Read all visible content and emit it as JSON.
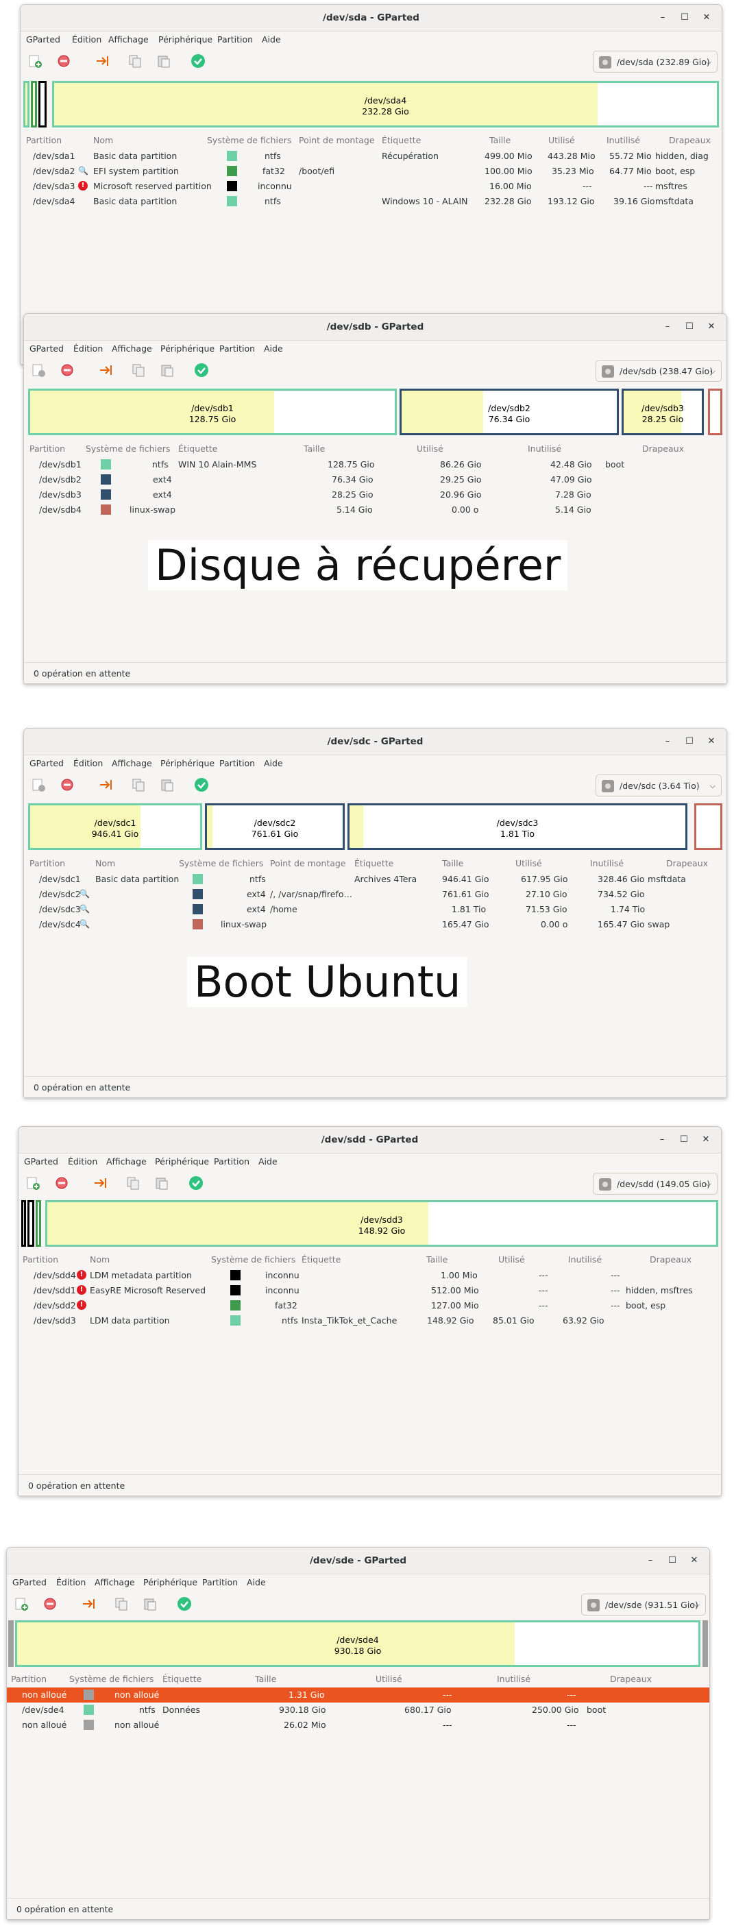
{
  "menu": [
    "GParted",
    "Édition",
    "Affichage",
    "Périphérique",
    "Partition",
    "Aide"
  ],
  "status": "0 opération en attente",
  "colors": {
    "ntfs": "#6fcfa7",
    "fat32": "#3e9c4c",
    "ext4": "#314e6c",
    "swap": "#c1665a",
    "inconnu": "#000000",
    "nonalloue": "#a0a0a0",
    "selection": "#e95420"
  },
  "sda": {
    "title": "/dev/sda - GParted",
    "device": "/dev/sda (232.89 Gio)",
    "bar": {
      "name": "/dev/sda4",
      "size": "232.28 Gio"
    },
    "headers": [
      "Partition",
      "Nom",
      "Système de fichiers",
      "Point de montage",
      "Étiquette",
      "Taille",
      "Utilisé",
      "Inutilisé",
      "Drapeaux"
    ],
    "rows": [
      {
        "part": "/dev/sda1",
        "nom": "Basic data partition",
        "fs": "ntfs",
        "mount": "",
        "label": "Récupération",
        "size": "499.00 Mio",
        "used": "443.28 Mio",
        "unused": "55.72 Mio",
        "flags": "hidden, diag"
      },
      {
        "part": "/dev/sda2",
        "nom": "EFI system partition",
        "fs": "fat32",
        "mount": "/boot/efi",
        "label": "",
        "size": "100.00 Mio",
        "used": "35.23 Mio",
        "unused": "64.77 Mio",
        "flags": "boot, esp"
      },
      {
        "part": "/dev/sda3",
        "nom": "Microsoft reserved partition",
        "fs": "inconnu",
        "mount": "",
        "label": "",
        "size": "16.00 Mio",
        "used": "---",
        "unused": "---",
        "flags": "msftres"
      },
      {
        "part": "/dev/sda4",
        "nom": "Basic data partition",
        "fs": "ntfs",
        "mount": "",
        "label": "Windows 10 - ALAIN",
        "size": "232.28 Gio",
        "used": "193.12 Gio",
        "unused": "39.16 Gio",
        "flags": "msftdata"
      }
    ]
  },
  "sdb": {
    "title": "/dev/sdb - GParted",
    "device": "/dev/sdb (238.47 Gio)",
    "bars": [
      {
        "name": "/dev/sdb1",
        "size": "128.75 Gio"
      },
      {
        "name": "/dev/sdb2",
        "size": "76.34 Gio"
      },
      {
        "name": "/dev/sdb3",
        "size": "28.25 Gio"
      }
    ],
    "headers": [
      "Partition",
      "Système de fichiers",
      "Étiquette",
      "Taille",
      "Utilisé",
      "Inutilisé",
      "Drapeaux"
    ],
    "rows": [
      {
        "part": "/dev/sdb1",
        "fs": "ntfs",
        "label": "WIN 10 Alain-MMS",
        "size": "128.75 Gio",
        "used": "86.26 Gio",
        "unused": "42.48 Gio",
        "flags": "boot"
      },
      {
        "part": "/dev/sdb2",
        "fs": "ext4",
        "label": "",
        "size": "76.34 Gio",
        "used": "29.25 Gio",
        "unused": "47.09 Gio",
        "flags": ""
      },
      {
        "part": "/dev/sdb3",
        "fs": "ext4",
        "label": "",
        "size": "28.25 Gio",
        "used": "20.96 Gio",
        "unused": "7.28 Gio",
        "flags": ""
      },
      {
        "part": "/dev/sdb4",
        "fs": "linux-swap",
        "label": "",
        "size": "5.14 Gio",
        "used": "0.00 o",
        "unused": "5.14 Gio",
        "flags": ""
      }
    ],
    "caption": "Disque à récupérer"
  },
  "sdc": {
    "title": "/dev/sdc - GParted",
    "device": "/dev/sdc (3.64 Tio)",
    "bars": [
      {
        "name": "/dev/sdc1",
        "size": "946.41 Gio"
      },
      {
        "name": "/dev/sdc2",
        "size": "761.61 Gio"
      },
      {
        "name": "/dev/sdc3",
        "size": "1.81 Tio"
      }
    ],
    "headers": [
      "Partition",
      "Nom",
      "Système de fichiers",
      "Point de montage",
      "Étiquette",
      "Taille",
      "Utilisé",
      "Inutilisé",
      "Drapeaux"
    ],
    "rows": [
      {
        "part": "/dev/sdc1",
        "nom": "Basic data partition",
        "fs": "ntfs",
        "mount": "",
        "label": "Archives 4Tera",
        "size": "946.41 Gio",
        "used": "617.95 Gio",
        "unused": "328.46 Gio",
        "flags": "msftdata"
      },
      {
        "part": "/dev/sdc2",
        "nom": "",
        "fs": "ext4",
        "mount": "/, /var/snap/firefo…",
        "label": "",
        "size": "761.61 Gio",
        "used": "27.10 Gio",
        "unused": "734.52 Gio",
        "flags": ""
      },
      {
        "part": "/dev/sdc3",
        "nom": "",
        "fs": "ext4",
        "mount": "/home",
        "label": "",
        "size": "1.81 Tio",
        "used": "71.53 Gio",
        "unused": "1.74 Tio",
        "flags": ""
      },
      {
        "part": "/dev/sdc4",
        "nom": "",
        "fs": "linux-swap",
        "mount": "",
        "label": "",
        "size": "165.47 Gio",
        "used": "0.00 o",
        "unused": "165.47 Gio",
        "flags": "swap"
      }
    ],
    "caption": "Boot Ubuntu"
  },
  "sdd": {
    "title": "/dev/sdd - GParted",
    "device": "/dev/sdd (149.05 Gio)",
    "bar": {
      "name": "/dev/sdd3",
      "size": "148.92 Gio"
    },
    "headers": [
      "Partition",
      "Nom",
      "Système de fichiers",
      "Étiquette",
      "Taille",
      "Utilisé",
      "Inutilisé",
      "Drapeaux"
    ],
    "rows": [
      {
        "part": "/dev/sdd4",
        "nom": "LDM metadata partition",
        "fs": "inconnu",
        "label": "",
        "size": "1.00 Mio",
        "used": "---",
        "unused": "---",
        "flags": ""
      },
      {
        "part": "/dev/sdd1",
        "nom": "EasyRE Microsoft Reserved",
        "fs": "inconnu",
        "label": "",
        "size": "512.00 Mio",
        "used": "---",
        "unused": "---",
        "flags": "hidden, msftres"
      },
      {
        "part": "/dev/sdd2",
        "nom": "",
        "fs": "fat32",
        "label": "",
        "size": "127.00 Mio",
        "used": "---",
        "unused": "---",
        "flags": "boot, esp"
      },
      {
        "part": "/dev/sdd3",
        "nom": "LDM data partition",
        "fs": "ntfs",
        "label": "Insta_TikTok_et_Cache",
        "size": "148.92 Gio",
        "used": "85.01 Gio",
        "unused": "63.92 Gio",
        "flags": ""
      }
    ]
  },
  "sde": {
    "title": "/dev/sde - GParted",
    "device": "/dev/sde (931.51 Gio)",
    "bar": {
      "name": "/dev/sde4",
      "size": "930.18 Gio"
    },
    "headers": [
      "Partition",
      "Système de fichiers",
      "Étiquette",
      "Taille",
      "Utilisé",
      "Inutilisé",
      "Drapeaux"
    ],
    "rows": [
      {
        "part": "non alloué",
        "fs": "non alloué",
        "label": "",
        "size": "1.31 Gio",
        "used": "---",
        "unused": "---",
        "flags": ""
      },
      {
        "part": "/dev/sde4",
        "fs": "ntfs",
        "label": "Données",
        "size": "930.18 Gio",
        "used": "680.17 Gio",
        "unused": "250.00 Gio",
        "flags": "boot"
      },
      {
        "part": "non alloué",
        "fs": "non alloué",
        "label": "",
        "size": "26.02 Mio",
        "used": "---",
        "unused": "---",
        "flags": ""
      }
    ]
  }
}
